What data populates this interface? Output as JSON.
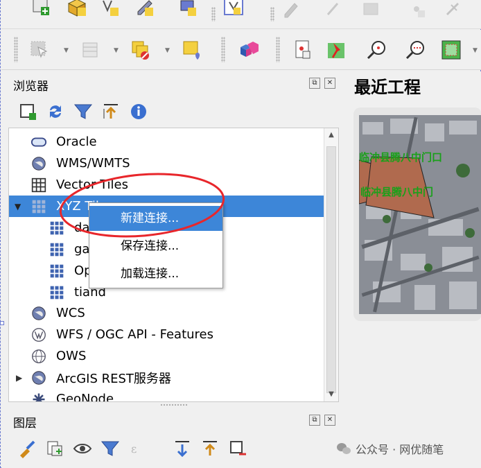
{
  "browser_panel": {
    "title": "浏览器",
    "items": [
      {
        "label": "Oracle",
        "icon": "oracle-db-icon"
      },
      {
        "label": "WMS/WMTS",
        "icon": "globe-icon"
      },
      {
        "label": "Vector Tiles",
        "icon": "grid-icon"
      },
      {
        "label": "XYZ Tiles",
        "icon": "xyz-grid-icon",
        "expanded": true,
        "selected": true
      },
      {
        "label": "da",
        "icon": "tile-grid-icon",
        "child": true
      },
      {
        "label": "ga",
        "icon": "tile-grid-icon",
        "child": true
      },
      {
        "label": "Op",
        "icon": "tile-grid-icon",
        "child": true
      },
      {
        "label": "tiand",
        "icon": "tile-grid-icon",
        "child": true
      },
      {
        "label": "WCS",
        "icon": "globe-icon"
      },
      {
        "label": "WFS / OGC API - Features",
        "icon": "wfs-icon"
      },
      {
        "label": "OWS",
        "icon": "globe-outline-icon"
      },
      {
        "label": "ArcGIS REST服务器",
        "icon": "globe-icon",
        "collapsed": true
      },
      {
        "label": "GeoNode",
        "icon": "geonode-icon"
      }
    ]
  },
  "context_menu": {
    "items": [
      {
        "label": "新建连接...",
        "highlighted": true
      },
      {
        "label": "保存连接..."
      },
      {
        "label": "加载连接..."
      }
    ]
  },
  "recent_projects": {
    "title": "最近工程",
    "map_labels": [
      "临冲县腾八中门口",
      "临冲县腾八中门"
    ]
  },
  "layers_panel": {
    "title": "图层"
  },
  "watermark": {
    "text": "公众号 · 网优随笔"
  },
  "colors": {
    "selection": "#3d86d8",
    "annotation_ellipse": "#e8262b",
    "map_label": "#1aa01a",
    "polygon_fill": "#b06a4e"
  }
}
